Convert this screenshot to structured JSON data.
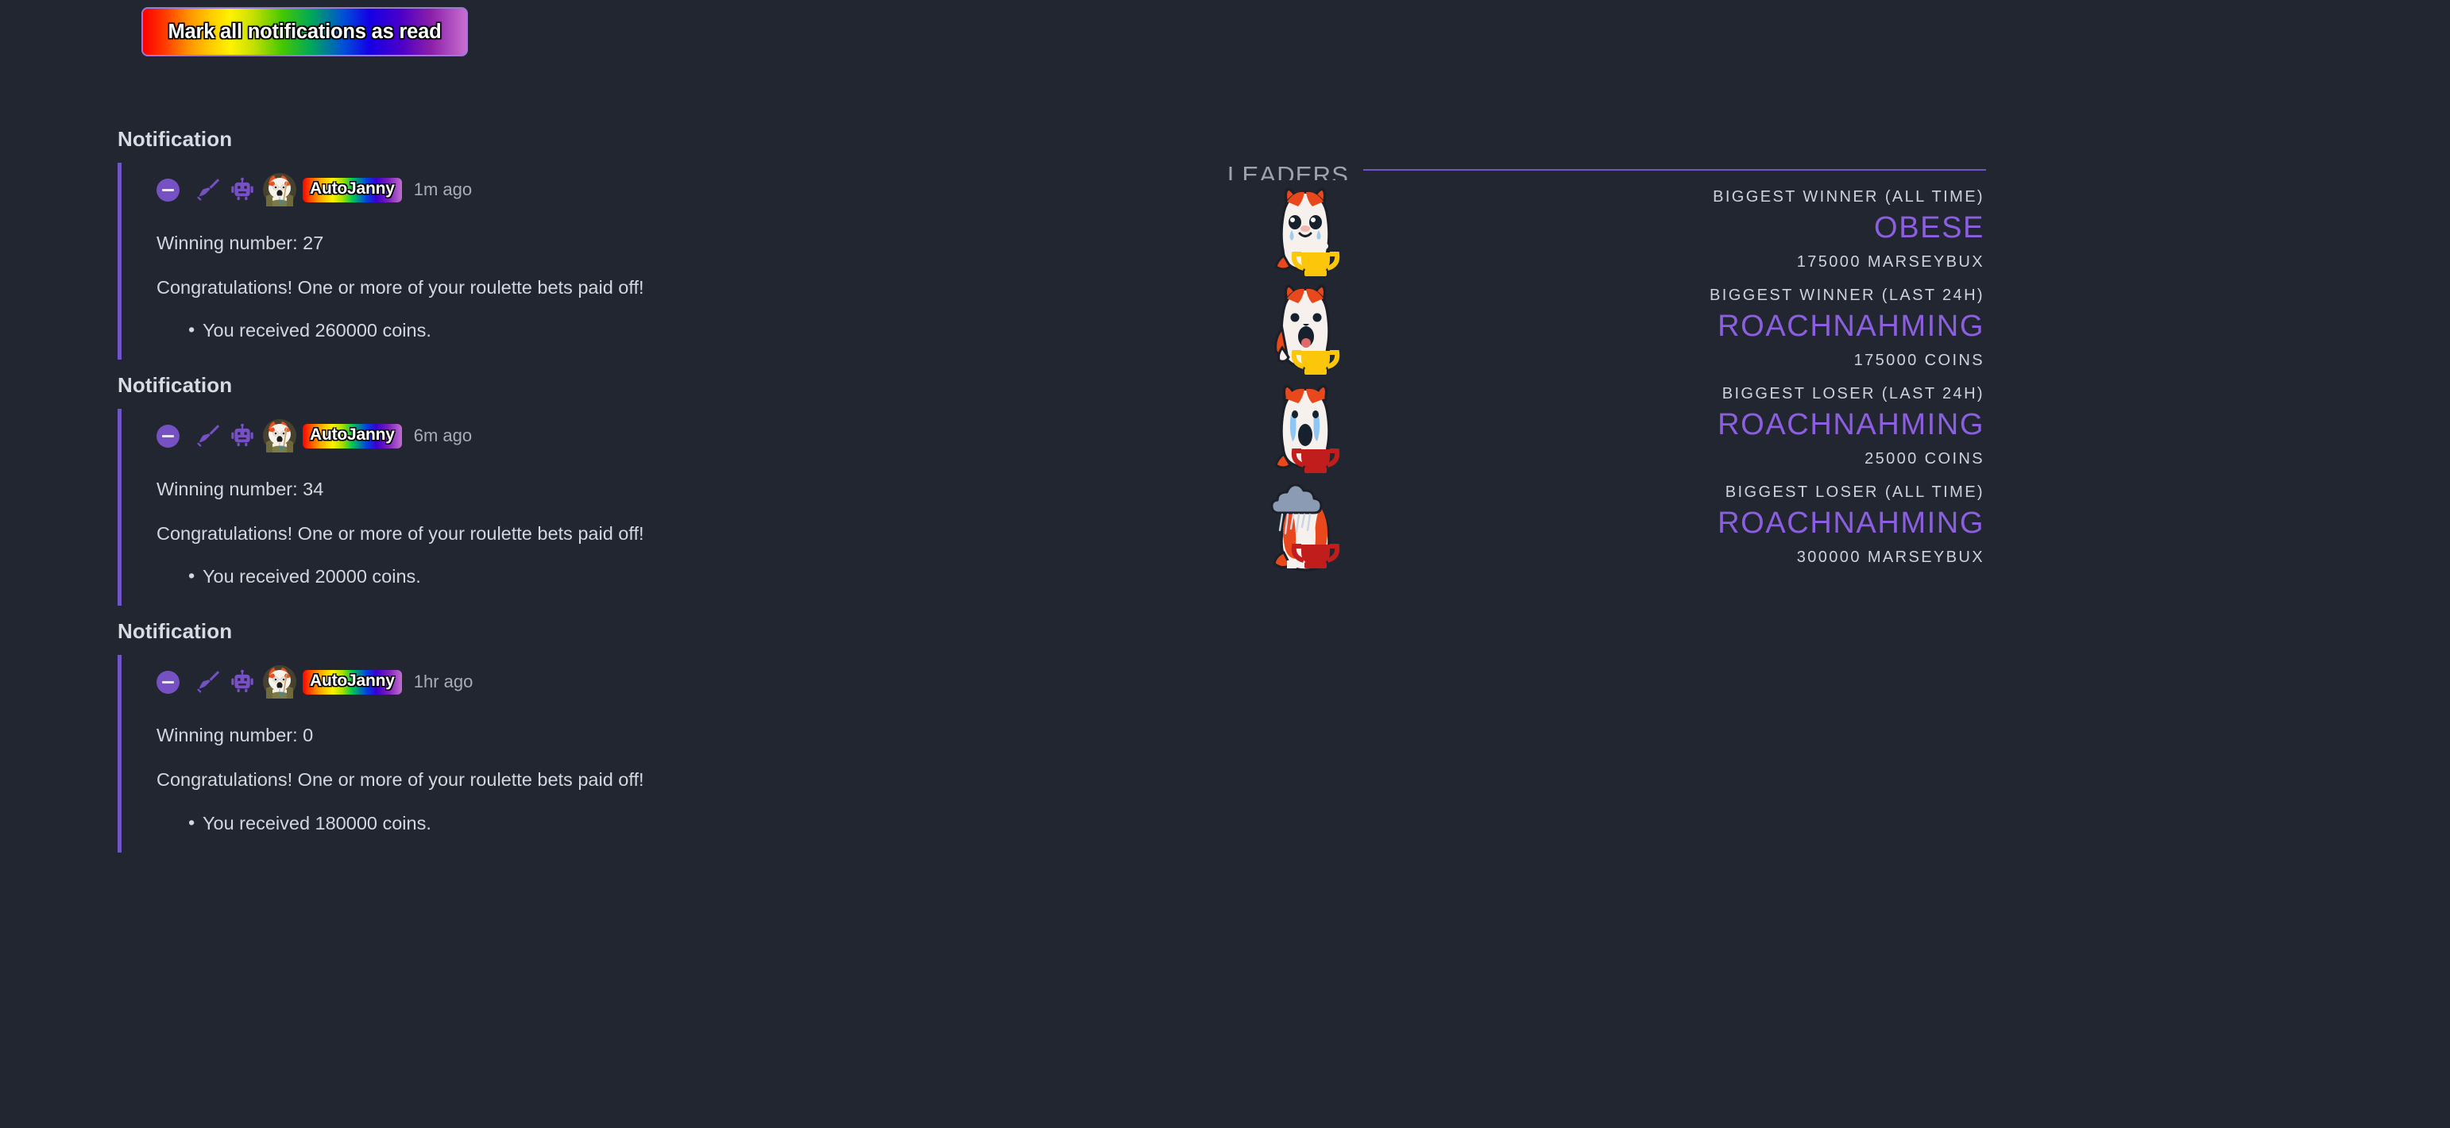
{
  "theme": {
    "background": "#212631",
    "accent_purple": "#6f55c8",
    "username_purple": "#8c5fe0",
    "text_primary": "#d3d7de",
    "text_muted": "#a7adb8"
  },
  "toolbar": {
    "mark_all_read_label": "Mark all notifications as read"
  },
  "notifications": [
    {
      "title": "Notification",
      "icons": [
        "minus-circle-icon",
        "broom-icon",
        "robot-icon"
      ],
      "avatar": "autojanny-avatar",
      "username": "AutoJanny",
      "timestamp": "1m ago",
      "winning_line": "Winning number: 27",
      "message": "Congratulations! One or more of your roulette bets paid off!",
      "bullets": [
        "You received 260000 coins."
      ]
    },
    {
      "title": "Notification",
      "icons": [
        "minus-circle-icon",
        "broom-icon",
        "robot-icon"
      ],
      "avatar": "autojanny-avatar",
      "username": "AutoJanny",
      "timestamp": "6m ago",
      "winning_line": "Winning number: 34",
      "message": "Congratulations! One or more of your roulette bets paid off!",
      "bullets": [
        "You received 20000 coins."
      ]
    },
    {
      "title": "Notification",
      "icons": [
        "minus-circle-icon",
        "broom-icon",
        "robot-icon"
      ],
      "avatar": "autojanny-avatar",
      "username": "AutoJanny",
      "timestamp": "1hr ago",
      "winning_line": "Winning number: 0",
      "message": "Congratulations! One or more of your roulette bets paid off!",
      "bullets": [
        "You received 180000 coins."
      ]
    }
  ],
  "leaders": {
    "title": "LEADERS",
    "rows": [
      {
        "mascot": "marsey-crying-gold-trophy",
        "label": "BIGGEST WINNER (ALL TIME)",
        "name": "OBESE",
        "amount": "175000 MARSEYBUX"
      },
      {
        "mascot": "marsey-cheering-gold-trophy",
        "label": "BIGGEST WINNER (LAST 24H)",
        "name": "ROACHNAHMING",
        "amount": "175000 COINS"
      },
      {
        "mascot": "marsey-sobbing-red-trophy",
        "label": "BIGGEST LOSER (LAST 24H)",
        "name": "ROACHNAHMING",
        "amount": "25000 COINS"
      },
      {
        "mascot": "marsey-raincloud-red-trophy",
        "label": "BIGGEST LOSER (ALL TIME)",
        "name": "ROACHNAHMING",
        "amount": "300000 MARSEYBUX"
      }
    ]
  }
}
